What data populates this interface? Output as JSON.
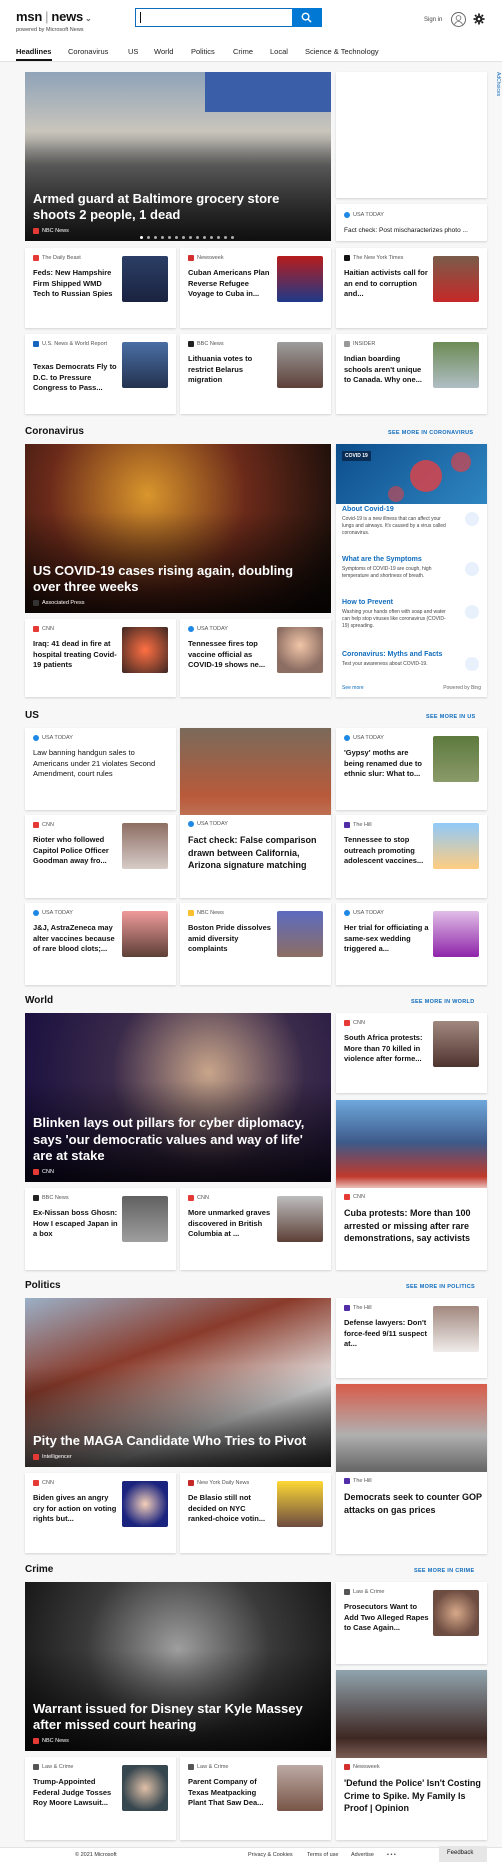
{
  "header": {
    "brand": "msn",
    "section": "news",
    "powered_by": "powered by Microsoft News",
    "signin": "Sign in"
  },
  "nav": [
    "Headlines",
    "Coronavirus",
    "US",
    "World",
    "Politics",
    "Crime",
    "Local",
    "Science & Technology"
  ],
  "ad_label": "AdChoices",
  "top": {
    "hero": {
      "title": "Armed guard at Baltimore grocery store shoots 2 people, 1 dead",
      "source": "NBC News"
    },
    "side": {
      "source": "USA TODAY",
      "title": "Fact check: Post mischaracterizes photo ..."
    },
    "cards": [
      {
        "source": "The Daily Beast",
        "title": "Feds: New Hampshire Firm Shipped WMD Tech to Russian Spies"
      },
      {
        "source": "Newsweek",
        "title": "Cuban Americans Plan Reverse Refugee Voyage to Cuba in..."
      },
      {
        "source": "The New York Times",
        "title": "Haitian activists call for an end to corruption and..."
      },
      {
        "source": "U.S. News & World Report",
        "title": "Texas Democrats Fly to D.C. to Pressure Congress to Pass..."
      },
      {
        "source": "BBC News",
        "title": "Lithuania votes to restrict Belarus migration"
      },
      {
        "source": "INSIDER",
        "title": "Indian boarding schools aren't unique to Canada. Why one..."
      }
    ]
  },
  "coronavirus": {
    "title": "Coronavirus",
    "see_more": "SEE MORE IN CORONAVIRUS",
    "hero": {
      "title": "US COVID-19 cases rising again, doubling over three weeks",
      "source": "Associated Press"
    },
    "cards": [
      {
        "source": "CNN",
        "title": "Iraq: 41 dead in fire at hospital treating Covid-19 patients"
      },
      {
        "source": "USA TODAY",
        "title": "Tennessee fires top vaccine official as COVID-19 shows ne..."
      }
    ],
    "panel": {
      "tag": "COVID 19",
      "items": [
        {
          "h": "About Covid-19",
          "d": "Covid-19 is a new illness that can affect your lungs and airways. It's caused by a virus called coronavirus."
        },
        {
          "h": "What are the Symptoms",
          "d": "Symptoms of COVID-19 are cough, high temperature and shortness of breath."
        },
        {
          "h": "How to Prevent",
          "d": "Washing your hands often with soap and water can help stop viruses like coronavirus (COVID-19) spreading."
        },
        {
          "h": "Coronavirus: Myths and Facts",
          "d": "Test your awareness about COVID-19."
        }
      ],
      "see_more": "See more",
      "powered": "Powered by Bing"
    }
  },
  "us": {
    "title": "US",
    "see_more": "SEE MORE IN US",
    "cards": [
      {
        "source": "USA TODAY",
        "title": "Law banning handgun sales to Americans under 21 violates Second Amendment, court rules"
      },
      {
        "source": "USA TODAY",
        "title": "'Gypsy' moths are being renamed due to ethnic slur: What to..."
      },
      {
        "source": "CNN",
        "title": "Rioter who followed Capitol Police Officer Goodman away fro..."
      },
      {
        "source": "USA TODAY",
        "title": "Fact check: False comparison drawn between California, Arizona signature matching"
      },
      {
        "source": "The Hill",
        "title": "Tennessee to stop outreach promoting adolescent vaccines..."
      },
      {
        "source": "USA TODAY",
        "title": "J&J, AstraZeneca may alter vaccines because of rare blood clots;..."
      },
      {
        "source": "NBC News",
        "title": "Boston Pride dissolves amid diversity complaints"
      },
      {
        "source": "USA TODAY",
        "title": "Her trial for officiating a same-sex wedding triggered a..."
      }
    ]
  },
  "world": {
    "title": "World",
    "see_more": "SEE MORE IN WORLD",
    "hero": {
      "title": "Blinken lays out pillars for cyber diplomacy, says 'our democratic values and way of life' are at stake",
      "source": "CNN"
    },
    "cards": [
      {
        "source": "CNN",
        "title": "South Africa protests: More than 70 killed in violence after forme..."
      },
      {
        "source": "CNN",
        "title": "Cuba protests: More than 100 arrested or missing after rare demonstrations, say activists"
      },
      {
        "source": "BBC News",
        "title": "Ex-Nissan boss Ghosn: How I escaped Japan in a box"
      },
      {
        "source": "CNN",
        "title": "More unmarked graves discovered in British Columbia at ..."
      }
    ]
  },
  "politics": {
    "title": "Politics",
    "see_more": "SEE MORE IN POLITICS",
    "hero": {
      "title": "Pity the MAGA Candidate Who Tries to Pivot",
      "source": "Intelligencer"
    },
    "cards": [
      {
        "source": "The Hill",
        "title": "Defense lawyers: Don't force-feed 9/11 suspect at..."
      },
      {
        "source": "The Hill",
        "title": "Democrats seek to counter GOP attacks on gas prices"
      },
      {
        "source": "CNN",
        "title": "Biden gives an angry cry for action on voting rights but..."
      },
      {
        "source": "New York Daily News",
        "title": "De Blasio still not decided on NYC ranked-choice votin..."
      }
    ]
  },
  "crime": {
    "title": "Crime",
    "see_more": "SEE MORE IN CRIME",
    "hero": {
      "title": "Warrant issued for Disney star Kyle Massey after missed court hearing",
      "source": "NBC News"
    },
    "cards": [
      {
        "source": "Law & Crime",
        "title": "Prosecutors Want to Add Two Alleged Rapes to Case Again..."
      },
      {
        "source": "Newsweek",
        "title": "'Defund the Police' Isn't Costing Crime to Spike. My Family Is Proof | Opinion"
      },
      {
        "source": "Law & Crime",
        "title": "Trump-Appointed Federal Judge Tosses Roy Moore Lawsuit..."
      },
      {
        "source": "Law & Crime",
        "title": "Parent Company of Texas Meatpacking Plant That Saw Dea..."
      }
    ]
  },
  "footer": {
    "copyright": "© 2021 Microsoft",
    "links": [
      "Privacy & Cookies",
      "Terms of use",
      "Advertise",
      "• • •"
    ],
    "feedback": "Feedback"
  },
  "colors": {
    "accent": "#0078d4",
    "link": "#0f6cbd"
  }
}
